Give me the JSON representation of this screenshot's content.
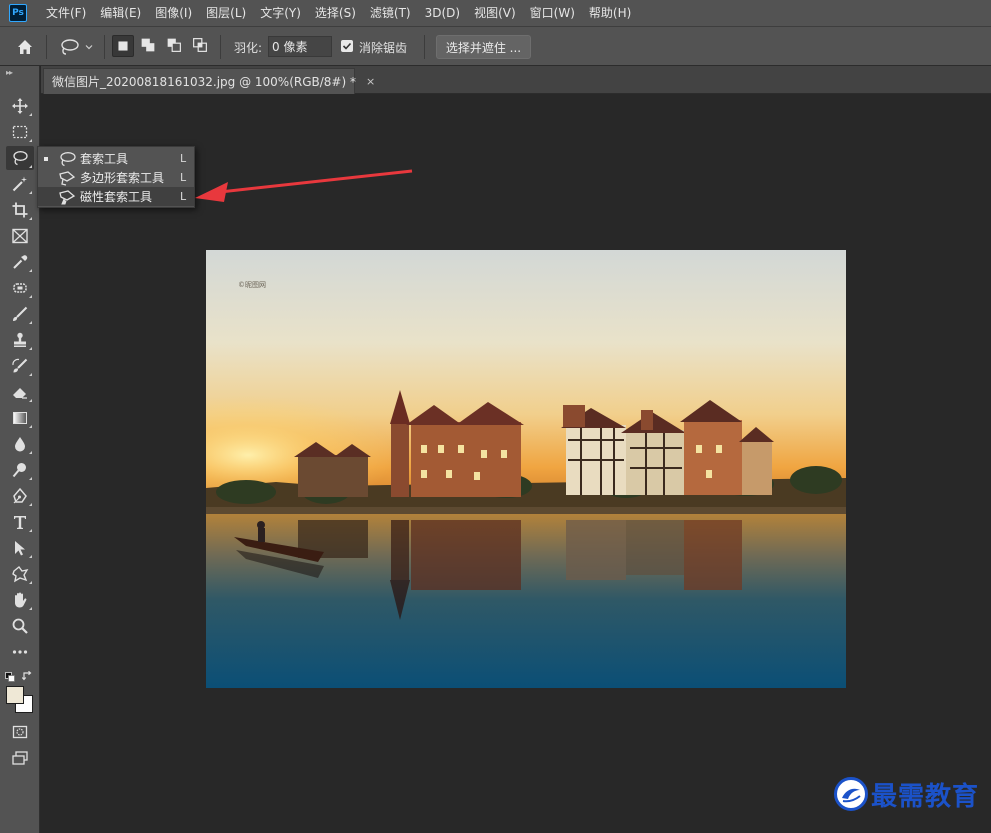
{
  "app": {
    "logo_text": "Ps"
  },
  "menu": [
    "文件(F)",
    "编辑(E)",
    "图像(I)",
    "图层(L)",
    "文字(Y)",
    "选择(S)",
    "滤镜(T)",
    "3D(D)",
    "视图(V)",
    "窗口(W)",
    "帮助(H)"
  ],
  "options": {
    "feather_label": "羽化:",
    "feather_value": "0 像素",
    "antialias_label": "消除锯齿",
    "antialias_checked": true,
    "select_mask_label": "选择并遮住 ..."
  },
  "document": {
    "tab_title": "微信图片_20200818161032.jpg @ 100%(RGB/8#) *",
    "close_glyph": "×",
    "image_caption": "©昵图网"
  },
  "flyout": {
    "items": [
      {
        "label": "套索工具",
        "shortcut": "L",
        "active": true,
        "icon": "lasso-icon"
      },
      {
        "label": "多边形套索工具",
        "shortcut": "L",
        "active": false,
        "icon": "polygonal-lasso-icon"
      },
      {
        "label": "磁性套索工具",
        "shortcut": "L",
        "active": false,
        "icon": "magnetic-lasso-icon"
      }
    ]
  },
  "colors": {
    "foreground": "#efe8d6",
    "background": "#ffffff",
    "arrow": "#e8383d",
    "watermark": "#1b52c9"
  },
  "watermark": {
    "text": "最需教育"
  }
}
